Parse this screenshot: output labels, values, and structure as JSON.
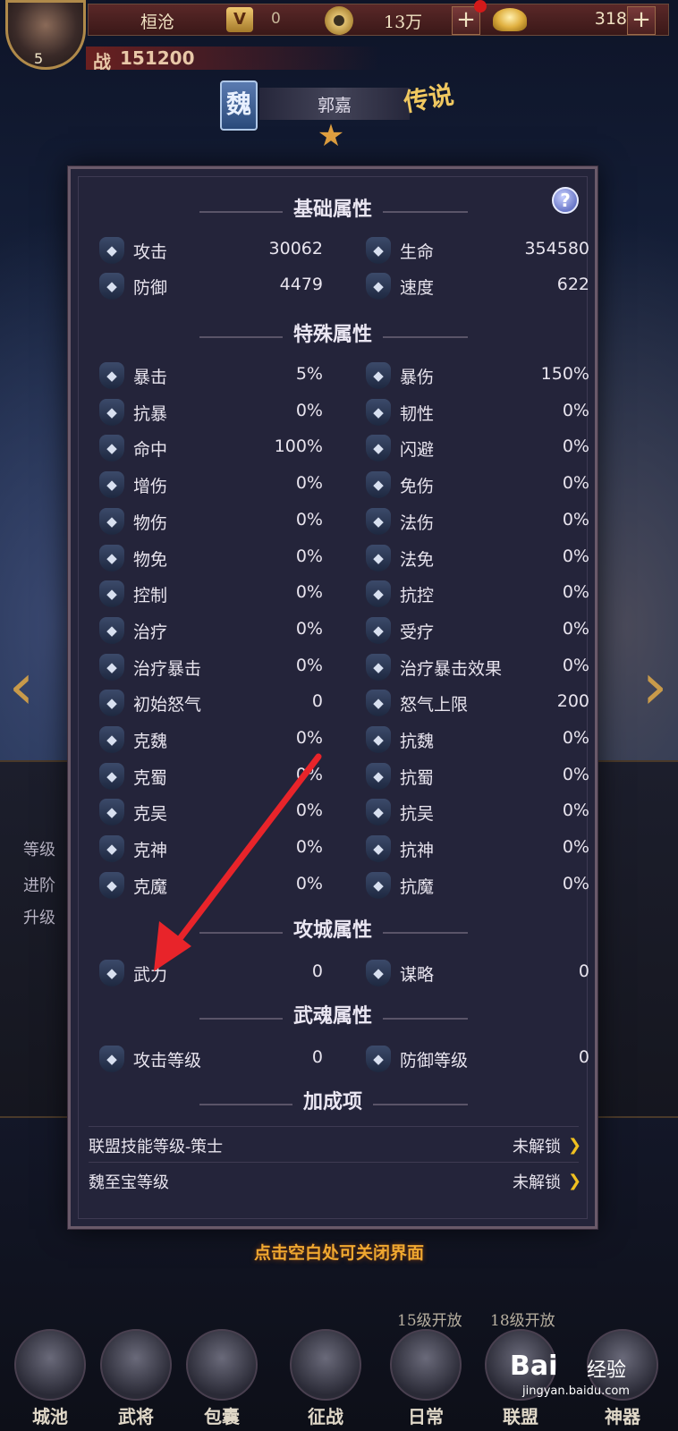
{
  "topbar": {
    "player_name": "桓沧",
    "player_level": "5",
    "vip_label": "V",
    "vip_value": "0",
    "coins": "13万",
    "plus": "+",
    "ingots": "318",
    "power_label": "战",
    "power_value": "151200"
  },
  "hero": {
    "faction": "魏",
    "name": "郭嘉",
    "rarity_badge": "传说"
  },
  "background_panel": {
    "items": [
      "等级",
      "进阶",
      "升级"
    ]
  },
  "modal": {
    "help": "?",
    "sections": {
      "basic": "基础属性",
      "special": "特殊属性",
      "siege": "攻城属性",
      "soul": "武魂属性",
      "bonus": "加成项"
    },
    "basic": [
      {
        "icon": "attack-icon",
        "label": "攻击",
        "value": "30062"
      },
      {
        "icon": "hp-icon",
        "label": "生命",
        "value": "354580"
      },
      {
        "icon": "defense-icon",
        "label": "防御",
        "value": "4479"
      },
      {
        "icon": "speed-icon",
        "label": "速度",
        "value": "622"
      }
    ],
    "special": [
      {
        "icon": "crit-icon",
        "label": "暴击",
        "value": "5%"
      },
      {
        "icon": "crit-damage-icon",
        "label": "暴伤",
        "value": "150%"
      },
      {
        "icon": "crit-resist-icon",
        "label": "抗暴",
        "value": "0%"
      },
      {
        "icon": "toughness-icon",
        "label": "韧性",
        "value": "0%"
      },
      {
        "icon": "accuracy-icon",
        "label": "命中",
        "value": "100%"
      },
      {
        "icon": "dodge-icon",
        "label": "闪避",
        "value": "0%"
      },
      {
        "icon": "damage-up-icon",
        "label": "增伤",
        "value": "0%"
      },
      {
        "icon": "damage-reduce-icon",
        "label": "免伤",
        "value": "0%"
      },
      {
        "icon": "physical-damage-icon",
        "label": "物伤",
        "value": "0%"
      },
      {
        "icon": "magic-damage-icon",
        "label": "法伤",
        "value": "0%"
      },
      {
        "icon": "physical-resist-icon",
        "label": "物免",
        "value": "0%"
      },
      {
        "icon": "magic-resist-icon",
        "label": "法免",
        "value": "0%"
      },
      {
        "icon": "control-icon",
        "label": "控制",
        "value": "0%"
      },
      {
        "icon": "control-resist-icon",
        "label": "抗控",
        "value": "0%"
      },
      {
        "icon": "heal-icon",
        "label": "治疗",
        "value": "0%"
      },
      {
        "icon": "healed-icon",
        "label": "受疗",
        "value": "0%"
      },
      {
        "icon": "heal-crit-icon",
        "label": "治疗暴击",
        "value": "0%"
      },
      {
        "icon": "heal-crit-effect-icon",
        "label": "治疗暴击效果",
        "value": "0%"
      },
      {
        "icon": "rage-start-icon",
        "label": "初始怒气",
        "value": "0"
      },
      {
        "icon": "rage-max-icon",
        "label": "怒气上限",
        "value": "200"
      },
      {
        "icon": "vs-wei-icon",
        "label": "克魏",
        "value": "0%"
      },
      {
        "icon": "resist-wei-icon",
        "label": "抗魏",
        "value": "0%"
      },
      {
        "icon": "vs-shu-icon",
        "label": "克蜀",
        "value": "0%"
      },
      {
        "icon": "resist-shu-icon",
        "label": "抗蜀",
        "value": "0%"
      },
      {
        "icon": "vs-wu-icon",
        "label": "克吴",
        "value": "0%"
      },
      {
        "icon": "resist-wu-icon",
        "label": "抗吴",
        "value": "0%"
      },
      {
        "icon": "vs-god-icon",
        "label": "克神",
        "value": "0%"
      },
      {
        "icon": "resist-god-icon",
        "label": "抗神",
        "value": "0%"
      },
      {
        "icon": "vs-demon-icon",
        "label": "克魔",
        "value": "0%"
      },
      {
        "icon": "resist-demon-icon",
        "label": "抗魔",
        "value": "0%"
      }
    ],
    "siege": [
      {
        "icon": "force-icon",
        "label": "武力",
        "value": "0"
      },
      {
        "icon": "strategy-icon",
        "label": "谋略",
        "value": "0"
      }
    ],
    "soul": [
      {
        "icon": "attack-icon",
        "label": "攻击等级",
        "value": "0"
      },
      {
        "icon": "defense-icon",
        "label": "防御等级",
        "value": "0"
      }
    ],
    "bonus": [
      {
        "label": "联盟技能等级-策士",
        "value": "未解锁"
      },
      {
        "label": "魏至宝等级",
        "value": "未解锁"
      }
    ],
    "close_hint": "点击空白处可关闭界面"
  },
  "bottom_nav": {
    "items": [
      "城池",
      "武将",
      "包囊",
      "征战",
      "日常",
      "联盟",
      "神器"
    ],
    "tips": [
      "15级开放",
      "18级开放"
    ]
  },
  "watermark": {
    "logo": "Bai",
    "text": "经验",
    "url": "jingyan.baidu.com"
  },
  "colors": {
    "modal_bg": "#24243a",
    "accent_gold": "#f0c020",
    "close_hint": "#f0a830",
    "annotation_red": "#e8242a"
  }
}
